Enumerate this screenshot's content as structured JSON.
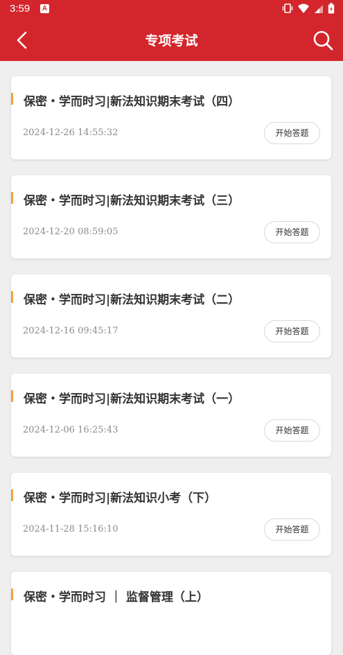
{
  "status_bar": {
    "time": "3:59",
    "notification_icon": "a-icon",
    "icons": [
      "vibrate-icon",
      "wifi-icon",
      "signal-icon",
      "battery-icon"
    ]
  },
  "header": {
    "title": "专项考试",
    "back_icon": "chevron-left-icon",
    "search_icon": "search-icon"
  },
  "colors": {
    "brand": "#d3262c",
    "accent": "#f0a33d"
  },
  "exams": [
    {
      "title": "保密・学而时习|新法知识期末考试（四）",
      "datetime": "2024-12-26  14:55:32",
      "button": "开始答题"
    },
    {
      "title": "保密・学而时习|新法知识期末考试（三）",
      "datetime": "2024-12-20  08:59:05",
      "button": "开始答题"
    },
    {
      "title": "保密・学而时习|新法知识期末考试（二）",
      "datetime": "2024-12-16  09:45:17",
      "button": "开始答题"
    },
    {
      "title": "保密・学而时习|新法知识期末考试（一）",
      "datetime": "2024-12-06  16:25:43",
      "button": "开始答题"
    },
    {
      "title": "保密・学而时习|新法知识小考（下）",
      "datetime": "2024-11-28  15:16:10",
      "button": "开始答题"
    },
    {
      "title": "保密・学而时习 ｜ 监督管理（上）",
      "datetime": "",
      "button": ""
    }
  ]
}
